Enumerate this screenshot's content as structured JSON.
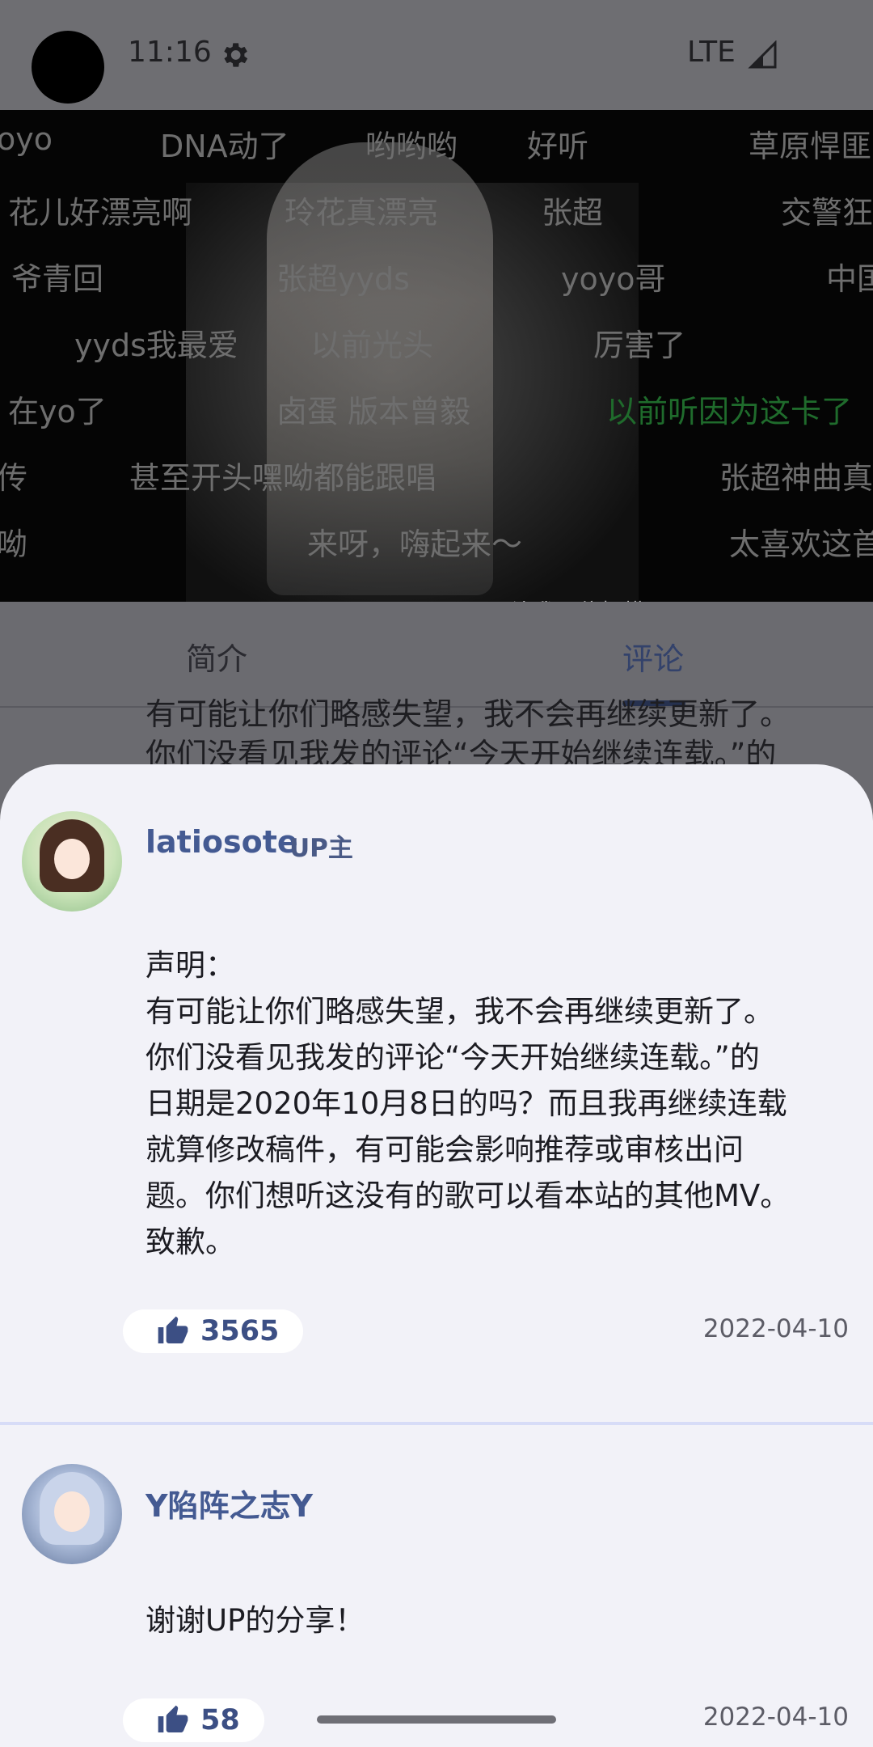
{
  "status_bar": {
    "time": "11:16",
    "network": "LTE",
    "icons": [
      "camera-cutout",
      "gear-icon",
      "signal-icon"
    ]
  },
  "video": {
    "subtitle": "让我不停捉摸",
    "danmaku": [
      {
        "text": "oyo",
        "color": "#6e6e6e"
      },
      {
        "text": "DNA动了",
        "color": "#6e6e6e"
      },
      {
        "text": "哟哟哟",
        "color": "#6e6e6e"
      },
      {
        "text": "好听",
        "color": "#6e6e6e"
      },
      {
        "text": "草原悍匪",
        "color": "#6e6e6e"
      },
      {
        "text": "花儿好漂亮啊",
        "color": "#6e6e6e"
      },
      {
        "text": "玲花真漂亮",
        "color": "#6e6e6e"
      },
      {
        "text": "张超",
        "color": "#6e6e6e"
      },
      {
        "text": "交警狂",
        "color": "#6e6e6e"
      },
      {
        "text": "爷青回",
        "color": "#6e6e6e"
      },
      {
        "text": "张超yyds",
        "color": "#6e6e6e"
      },
      {
        "text": "yoyo哥",
        "color": "#6e6e6e"
      },
      {
        "text": "中国",
        "color": "#6e6e6e"
      },
      {
        "text": "yyds我最爱",
        "color": "#6e6e6e"
      },
      {
        "text": "以前光头",
        "color": "#6e6e6e"
      },
      {
        "text": "厉害了",
        "color": "#6e6e6e"
      },
      {
        "text": "在yo了",
        "color": "#6e6e6e"
      },
      {
        "text": "卤蛋 版本曾毅",
        "color": "#6e6e6e"
      },
      {
        "text": "以前听因为这卡了",
        "color": "#1f6b2c"
      },
      {
        "text": "传",
        "color": "#6e6e6e"
      },
      {
        "text": "甚至开头嘿呦都能跟唱",
        "color": "#6e6e6e"
      },
      {
        "text": "张超神曲真",
        "color": "#6e6e6e"
      },
      {
        "text": "呦",
        "color": "#6e6e6e"
      },
      {
        "text": "来呀，嗨起来～",
        "color": "#6e6e6e"
      },
      {
        "text": "太喜欢这首",
        "color": "#6e6e6e"
      }
    ]
  },
  "tabs": [
    {
      "label": "简介",
      "active": false
    },
    {
      "label": "评论",
      "active": true
    }
  ],
  "background_comment": {
    "line1": "有可能让你们略感失望，我不会再继续更新了。",
    "line2": "你们没看见我发的评论“今天开始继续连载。”的"
  },
  "comments": [
    {
      "username": "latiosote",
      "badge": "UP主",
      "lines": [
        "声明：",
        "有可能让你们略感失望，我不会再继续更新了。",
        "你们没看见我发的评论“今天开始继续连载。”的",
        "日期是2020年10月8日的吗？而且我再继续连载",
        "就算修改稿件，有可能会影响推荐或审核出问",
        "题。你们想听这没有的歌可以看本站的其他MV。",
        "致歉。"
      ],
      "likes": "3565",
      "date": "2022-04-10"
    },
    {
      "username": "Y陷阵之志Y",
      "lines": [
        "谢谢UP的分享！"
      ],
      "likes": "58",
      "date": "2022-04-10"
    }
  ],
  "colors": {
    "accent": "#445a92",
    "sheet_bg": "#f2f2f8",
    "scrim": "#6b6b70",
    "separator": "#d7dcf7"
  }
}
